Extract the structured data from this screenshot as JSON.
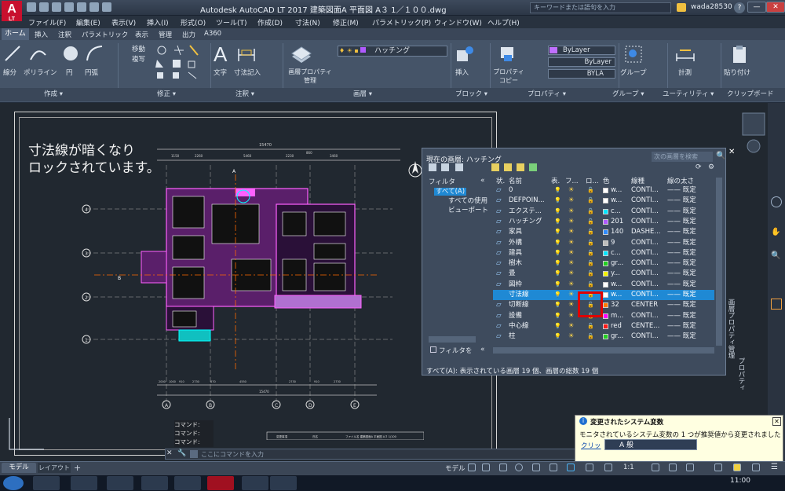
{
  "title_bar": {
    "logo_text": "A",
    "logo_sub": "LT",
    "app_title": "Autodesk AutoCAD LT 2017   建築図面A  平面図  A３  1／１００.dwg",
    "search_placeholder": "キーワードまたは語句を入力",
    "user": "wada28530",
    "min": "—",
    "max": "□",
    "close": "✕"
  },
  "menu": [
    "ファイル(F)",
    "編集(E)",
    "表示(V)",
    "挿入(I)",
    "形式(O)",
    "ツール(T)",
    "作成(D)",
    "寸法(N)",
    "修正(M)",
    "パラメトリック(P)",
    "ウィンドウ(W)",
    "ヘルプ(H)"
  ],
  "ribbon_tabs": [
    "ホーム",
    "挿入",
    "注釈",
    "パラメトリック",
    "表示",
    "管理",
    "出力",
    "A360"
  ],
  "ribbon": {
    "draw": [
      "線分",
      "ポリライン",
      "円",
      "円弧"
    ],
    "modify": [
      "移動",
      "複写"
    ],
    "annotation": [
      "文字",
      "寸法記入"
    ],
    "layer_props": "画層プロパティ管理",
    "layer_current": "ハッチング",
    "insert": "挿入",
    "properties": "プロパティコピー",
    "bylayer1": "ByLayer",
    "bylayer2": "ByLayer",
    "bylayer3": "BYLA",
    "group": "グループ",
    "measure": "計測",
    "paste": "貼り付け"
  },
  "panel_titles": [
    "作成 ▾",
    "修正 ▾",
    "注釈 ▾",
    "画層 ▾",
    "ブロック ▾",
    "プロパティ ▾",
    "グループ ▾",
    "ユーティリティ ▾",
    "クリップボード"
  ],
  "drawing": {
    "note_line1": "寸法線が暗くなり",
    "note_line2": "ロックされています。",
    "dim_total": "15470",
    "dims_top": [
      "1150",
      "2260",
      "5460",
      "2230",
      "860",
      "3460"
    ],
    "dims_bottom": [
      "2000",
      "1000",
      "910",
      "2730",
      "870",
      "4550",
      "2730",
      "910",
      "2730"
    ],
    "dim_bottom_total": "15470",
    "axes_bottom": [
      "A",
      "B",
      "C",
      "D",
      "E"
    ],
    "axes_left": [
      "4",
      "3",
      "2",
      "1"
    ],
    "section_labels": [
      "A",
      "B"
    ],
    "title_block": [
      "変更事項",
      "氏名",
      "ファイル名  建築図面A  平面図  A３  1/100"
    ]
  },
  "command": {
    "history": [
      "コマンド:",
      "コマンド:",
      "コマンド:"
    ],
    "x_icon": "✕",
    "input_placeholder": "ここにコマンドを入力"
  },
  "status": {
    "model_tab": "モデル",
    "layout_tab": "レイアウト1",
    "add_tab": "+",
    "model_label": "モデル",
    "scale": "1:1"
  },
  "layer_palette": {
    "title": "現在の画層: ハッチング",
    "search_placeholder": "次の画層を検索",
    "filter_header": "フィルタ",
    "tree": [
      "すべて(A)",
      "すべての使用",
      "ビューポート"
    ],
    "columns": [
      "状.",
      "名前",
      "表.",
      "フ...",
      "ロ...",
      "色",
      "線種",
      "線の太さ"
    ],
    "rows": [
      {
        "name": "0",
        "color": "w...",
        "swatch": "#ffffff",
        "linetype": "CONTI...",
        "lw": "—— 既定",
        "selected": false
      },
      {
        "name": "DEFPOIN...",
        "color": "w...",
        "swatch": "#ffffff",
        "linetype": "CONTI...",
        "lw": "—— 既定",
        "selected": false
      },
      {
        "name": "エクステ...",
        "color": "c...",
        "swatch": "#00e5ff",
        "linetype": "CONTI...",
        "lw": "—— 既定",
        "selected": false
      },
      {
        "name": "ハッチング",
        "color": "201",
        "swatch": "#b05aff",
        "linetype": "CONTI...",
        "lw": "—— 既定",
        "selected": false
      },
      {
        "name": "家具",
        "color": "140",
        "swatch": "#2f8cff",
        "linetype": "DASHE...",
        "lw": "—— 既定",
        "selected": false
      },
      {
        "name": "外構",
        "color": "9",
        "swatch": "#bdbdbd",
        "linetype": "CONTI...",
        "lw": "—— 既定",
        "selected": false
      },
      {
        "name": "建具",
        "color": "c...",
        "swatch": "#00e5ff",
        "linetype": "CONTI...",
        "lw": "—— 既定",
        "selected": false
      },
      {
        "name": "樹木",
        "color": "gr...",
        "swatch": "#22d022",
        "linetype": "CONTI...",
        "lw": "—— 既定",
        "selected": false
      },
      {
        "name": "畳",
        "color": "y...",
        "swatch": "#f2f200",
        "linetype": "CONTI...",
        "lw": "—— 既定",
        "selected": false
      },
      {
        "name": "図枠",
        "color": "w...",
        "swatch": "#ffffff",
        "linetype": "CONTI...",
        "lw": "—— 既定",
        "selected": false
      },
      {
        "name": "寸法線",
        "color": "w...",
        "swatch": "#ffffff",
        "linetype": "CONTI...",
        "lw": "—— 既定",
        "selected": true
      },
      {
        "name": "切断線",
        "color": "32",
        "swatch": "#ff7a00",
        "linetype": "CENTER",
        "lw": "—— 既定",
        "selected": false
      },
      {
        "name": "設備",
        "color": "m...",
        "swatch": "#ff00ff",
        "linetype": "CONTI...",
        "lw": "—— 既定",
        "selected": false
      },
      {
        "name": "中心線",
        "color": "red",
        "swatch": "#ff1a1a",
        "linetype": "CENTE...",
        "lw": "—— 既定",
        "selected": false
      },
      {
        "name": "柱",
        "color": "gr...",
        "swatch": "#22d022",
        "linetype": "CONTI...",
        "lw": "—— 既定",
        "selected": false
      }
    ],
    "filter_invert": "フィルタを",
    "status_text": "すべて(A): 表示されている画層 19 個、画層の総数 19 個",
    "side_title": "画層プロパティ管理",
    "side_title2": "プロパティ"
  },
  "notification": {
    "title": "変更されたシステム変数",
    "body": "モニタされているシステム変数の 1 つが推奨値から変更されました",
    "link": "クリッ",
    "close": "✕",
    "ime_text": "A 般"
  },
  "tray": {
    "time": "11:00"
  }
}
